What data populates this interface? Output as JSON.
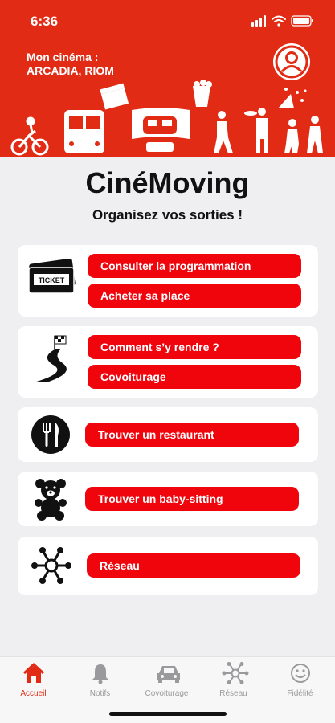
{
  "status_bar": {
    "time": "6:36"
  },
  "header": {
    "cinema_label": "Mon cinéma :",
    "cinema_name": "ARCADIA, RIOM"
  },
  "app": {
    "title": "CinéMoving",
    "subtitle": "Organisez vos sorties !"
  },
  "cards": {
    "tickets": {
      "icon": "ticket-icon",
      "buttons": [
        "Consulter la programmation",
        "Acheter sa place"
      ]
    },
    "road": {
      "icon": "road-icon",
      "buttons": [
        "Comment s’y rendre ?",
        "Covoiturage"
      ]
    },
    "restaurant": {
      "icon": "restaurant-icon",
      "buttons": [
        "Trouver un restaurant"
      ]
    },
    "babysitting": {
      "icon": "teddy-bear-icon",
      "buttons": [
        "Trouver un baby-sitting"
      ]
    },
    "network": {
      "icon": "network-icon",
      "buttons": [
        "Réseau"
      ]
    }
  },
  "tabbar": {
    "tabs": [
      {
        "label": "Accueil",
        "icon": "home-icon",
        "active": true
      },
      {
        "label": "Notifs",
        "icon": "bell-icon"
      },
      {
        "label": "Covoiturage",
        "icon": "car-icon"
      },
      {
        "label": "Réseau",
        "icon": "network-icon"
      },
      {
        "label": "Fidélité",
        "icon": "smiley-icon"
      }
    ]
  },
  "colors": {
    "brand_red": "#e12b14",
    "button_red": "#f0050d",
    "background": "#efeff1"
  }
}
